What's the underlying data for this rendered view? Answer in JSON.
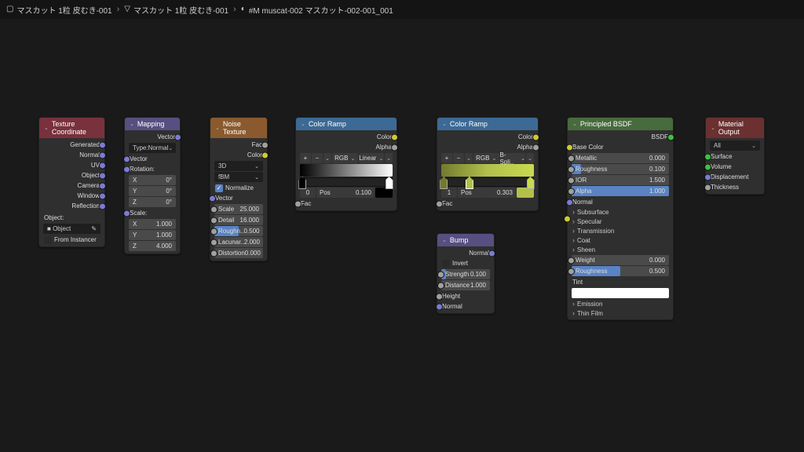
{
  "breadcrumb": [
    "マスカット 1粒 皮むき-001",
    "マスカット 1粒 皮むき-001",
    "#M muscat-002 マスカット-002-001_001"
  ],
  "texcoord": {
    "title": "Texture Coordinate",
    "outs": [
      "Generated",
      "Normal",
      "UV",
      "Object",
      "Camera",
      "Window",
      "Reflection"
    ],
    "object_label": "Object:",
    "object_hint": "Object",
    "from_instancer": "From Instancer"
  },
  "mapping": {
    "title": "Mapping",
    "out": "Vector",
    "type_label": "Type:",
    "type": "Normal",
    "in": "Vector",
    "rotation_lbl": "Rotation:",
    "rotation": [
      "0°",
      "0°",
      "0°"
    ],
    "scale_lbl": "Scale:",
    "scale": [
      "1.000",
      "1.000",
      "4.000"
    ]
  },
  "noise": {
    "title": "Noise Texture",
    "fac_lbl": "Fac",
    "color_lbl": "Color",
    "dim": "3D",
    "type": "fBM",
    "normalize": "Normalize",
    "vector_lbl": "Vector",
    "scale_lbl": "Scale",
    "scale": "25.000",
    "detail_lbl": "Detail",
    "detail": "16.000",
    "rough_lbl": "Roughn..",
    "rough": "0.500",
    "lacun_lbl": "Lacunar..",
    "lacun": "2.000",
    "dist_lbl": "Distortion",
    "dist": "0.000"
  },
  "ramp1": {
    "title": "Color Ramp",
    "color_lbl": "Color",
    "alpha_lbl": "Alpha",
    "mode": "RGB",
    "interp": "Linear",
    "stop_idx": "0",
    "pos_lbl": "Pos",
    "pos": "0.100",
    "fac_in": "Fac"
  },
  "ramp2": {
    "title": "Color Ramp",
    "color_lbl": "Color",
    "alpha_lbl": "Alpha",
    "mode": "RGB",
    "interp": "B-Spli..",
    "stop_idx": "1",
    "pos_lbl": "Pos",
    "pos": "0.303",
    "fac_in": "Fac"
  },
  "bump": {
    "title": "Bump",
    "out_normal": "Normal",
    "invert": "Invert",
    "strength_lbl": "Strength",
    "strength": "0.100",
    "distance_lbl": "Distance",
    "distance": "1.000",
    "height": "Height",
    "normal": "Normal"
  },
  "bsdf": {
    "title": "Principled BSDF",
    "out": "BSDF",
    "base_color": "Base Color",
    "metallic_lbl": "Metallic",
    "metallic": "0.000",
    "rough_lbl": "Roughness",
    "rough": "0.100",
    "ior_lbl": "IOR",
    "ior": "1.500",
    "alpha_lbl": "Alpha",
    "alpha": "1.000",
    "normal": "Normal",
    "panels": [
      "Subsurface",
      "Specular",
      "Transmission",
      "Coat",
      "Sheen",
      "Emission",
      "Thin Film"
    ],
    "weight_lbl": "Weight",
    "weight": "0.000",
    "rough2_lbl": "Roughness",
    "rough2": "0.500",
    "tint_lbl": "Tint"
  },
  "output": {
    "title": "Material Output",
    "target": "All",
    "surface": "Surface",
    "volume": "Volume",
    "displacement": "Displacement",
    "thickness": "Thickness"
  }
}
